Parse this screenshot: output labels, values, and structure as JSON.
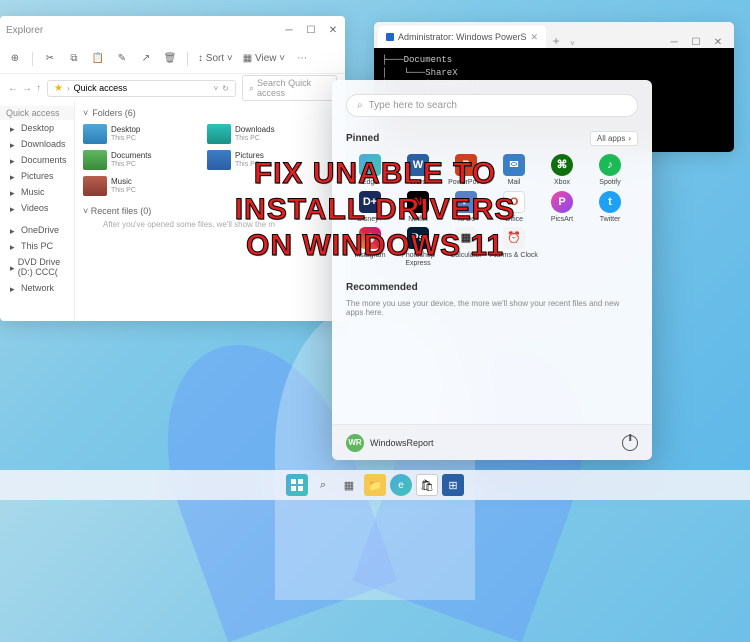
{
  "overlay": {
    "line1": "FIX UNABLE TO INSTALL DRIVERS",
    "line2": "ON WINDOWS 11"
  },
  "explorer": {
    "title": "Explorer",
    "toolbar": {
      "sort": "Sort",
      "view": "View"
    },
    "addressbar": {
      "location": "Quick access",
      "search_placeholder": "Search Quick access"
    },
    "sidebar": {
      "header": "Quick access",
      "items": [
        {
          "label": "Desktop"
        },
        {
          "label": "Downloads"
        },
        {
          "label": "Documents"
        },
        {
          "label": "Pictures"
        },
        {
          "label": "Music"
        },
        {
          "label": "Videos"
        }
      ],
      "groups": [
        {
          "label": "OneDrive"
        },
        {
          "label": "This PC"
        },
        {
          "label": "DVD Drive (D:) CCC("
        },
        {
          "label": "Network"
        }
      ]
    },
    "main": {
      "folders_header": "Folders (6)",
      "folders": [
        {
          "name": "Desktop",
          "sub": "This PC",
          "cls": "fi-blue"
        },
        {
          "name": "Downloads",
          "sub": "This PC",
          "cls": "fi-teal"
        },
        {
          "name": "Documents",
          "sub": "This PC",
          "cls": "fi-green"
        },
        {
          "name": "Pictures",
          "sub": "This PC",
          "cls": "fi-pic"
        },
        {
          "name": "Music",
          "sub": "This PC",
          "cls": "fi-music"
        }
      ],
      "recent_header": "Recent files (0)",
      "recent_hint": "After you've opened some files, we'll show the m"
    }
  },
  "powershell": {
    "tab_title": "Administrator: Windows PowerS",
    "output": "├───Documents\n│   └───ShareX\n│       ├───Backup\n│       ├───ImageEffects"
  },
  "startmenu": {
    "search_placeholder": "Type here to search",
    "pinned_header": "Pinned",
    "allapps_label": "All apps",
    "pinned": [
      {
        "label": "Edge",
        "cls": "pi-edge",
        "glyph": "e"
      },
      {
        "label": "Word",
        "cls": "pi-word",
        "glyph": "W"
      },
      {
        "label": "PowerPoint",
        "cls": "pi-ppt",
        "glyph": "P"
      },
      {
        "label": "Mail",
        "cls": "pi-mail",
        "glyph": "✉"
      },
      {
        "label": "Xbox",
        "cls": "pi-xbox",
        "glyph": "⌘"
      },
      {
        "label": "Spotify",
        "cls": "pi-spot",
        "glyph": "♪"
      },
      {
        "label": "Disney+",
        "cls": "pi-disney",
        "glyph": "D+"
      },
      {
        "label": "Netflix",
        "cls": "pi-netflix",
        "glyph": "N"
      },
      {
        "label": "To Do",
        "cls": "pi-todo",
        "glyph": "✓"
      },
      {
        "label": "Office",
        "cls": "pi-office",
        "glyph": "O"
      },
      {
        "label": "PicsArt",
        "cls": "pi-picsart",
        "glyph": "P"
      },
      {
        "label": "Twitter",
        "cls": "pi-twitter",
        "glyph": "t"
      },
      {
        "label": "Instagram",
        "cls": "pi-insta",
        "glyph": "◉"
      },
      {
        "label": "Photoshop Express",
        "cls": "pi-ps",
        "glyph": "Ps"
      },
      {
        "label": "Calculator",
        "cls": "pi-calc",
        "glyph": "▦"
      },
      {
        "label": "Alarms & Clock",
        "cls": "pi-clock",
        "glyph": "⏰"
      }
    ],
    "recommended_header": "Recommended",
    "recommended_hint": "The more you use your device, the more we'll show your recent files and new apps here.",
    "user": "WindowsReport",
    "user_initials": "WR"
  },
  "taskbar": {}
}
